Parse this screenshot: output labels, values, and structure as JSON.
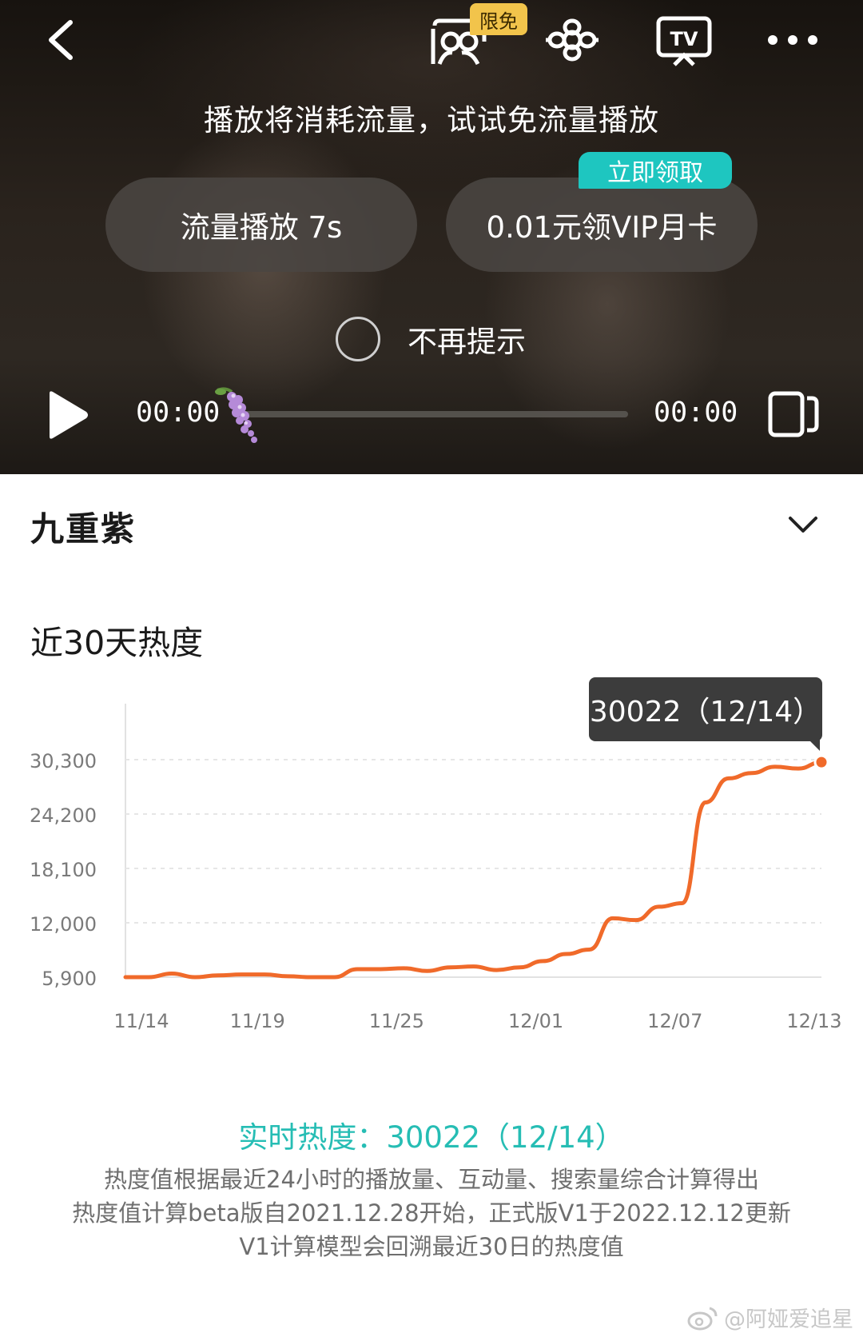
{
  "player": {
    "free_badge": "限免",
    "prompt": "播放将消耗流量，试试免流量播放",
    "data_play_button": "流量播放 7s",
    "vip_button": "0.01元领VIP月卡",
    "claim_tag": "立即领取",
    "no_remind_label": "不再提示",
    "current_time": "00:00",
    "total_time": "00:00",
    "progress": 0,
    "icons": [
      "back-arrow-icon",
      "vr-glasses-icon",
      "unicom-logo-icon",
      "tv-cast-icon",
      "more-dots-icon",
      "play-icon",
      "wisteria-thumb-icon",
      "fullscreen-icon"
    ]
  },
  "show": {
    "title": "九重紫"
  },
  "heat": {
    "section_title": "近30天热度",
    "tooltip": "30022（12/14）",
    "realtime": "实时热度：30022（12/14）",
    "note_1": "热度值根据最近24小时的播放量、互动量、搜索量综合计算得出",
    "note_2": "热度值计算beta版自2021.12.28开始，正式版V1于2022.12.12更新",
    "note_3": "V1计算模型会回溯最近30日的热度值"
  },
  "watermark": "@阿娅爱追星",
  "colors": {
    "line": "#f06a2a",
    "accent_teal": "#26bdb4",
    "claim_tag": "#1ec6c0",
    "free_badge": "#f2c44b"
  },
  "chart_data": {
    "type": "line",
    "title": "近30天热度",
    "xlabel": "",
    "ylabel": "",
    "x_ticks": [
      "11/14",
      "11/19",
      "11/25",
      "12/01",
      "12/07",
      "12/13"
    ],
    "y_ticks": [
      "5,900",
      "12,000",
      "18,100",
      "24,200",
      "30,300"
    ],
    "ylim": [
      5900,
      30300
    ],
    "grid": true,
    "x": [
      "11/14",
      "11/15",
      "11/16",
      "11/17",
      "11/18",
      "11/19",
      "11/20",
      "11/21",
      "11/22",
      "11/23",
      "11/24",
      "11/25",
      "11/26",
      "11/27",
      "11/28",
      "11/29",
      "11/30",
      "12/01",
      "12/02",
      "12/03",
      "12/04",
      "12/05",
      "12/06",
      "12/07",
      "12/08",
      "12/09",
      "12/10",
      "12/11",
      "12/12",
      "12/13",
      "12/14"
    ],
    "series": [
      {
        "values": [
          5900,
          5900,
          6300,
          5900,
          6100,
          6200,
          6200,
          6000,
          5900,
          5900,
          6800,
          6800,
          6900,
          6600,
          7000,
          7100,
          6700,
          7000,
          7700,
          8500,
          9000,
          12500,
          12300,
          13800,
          14200,
          25500,
          28200,
          28800,
          29500,
          29300,
          30022
        ]
      }
    ]
  }
}
